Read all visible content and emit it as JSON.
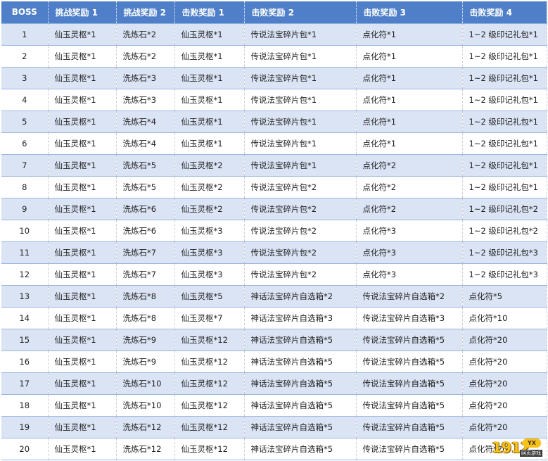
{
  "table": {
    "headers": [
      "BOSS",
      "挑战奖励 1",
      "挑战奖励 2",
      "击败奖励 1",
      "击败奖励 2",
      "击败奖励 3",
      "击败奖励 4"
    ],
    "rows": [
      [
        "1",
        "仙玉灵枢*1",
        "洗炼石*2",
        "仙玉灵枢*1",
        "传说法宝碎片包*1",
        "点化符*1",
        "1~2 级印记礼包*1"
      ],
      [
        "2",
        "仙玉灵枢*1",
        "洗炼石*2",
        "仙玉灵枢*1",
        "传说法宝碎片包*1",
        "点化符*1",
        "1~2 级印记礼包*1"
      ],
      [
        "3",
        "仙玉灵枢*1",
        "洗炼石*3",
        "仙玉灵枢*1",
        "传说法宝碎片包*1",
        "点化符*1",
        "1~2 级印记礼包*1"
      ],
      [
        "4",
        "仙玉灵枢*1",
        "洗炼石*3",
        "仙玉灵枢*1",
        "传说法宝碎片包*1",
        "点化符*1",
        "1~2 级印记礼包*1"
      ],
      [
        "5",
        "仙玉灵枢*1",
        "洗炼石*4",
        "仙玉灵枢*1",
        "传说法宝碎片包*1",
        "点化符*1",
        "1~2 级印记礼包*1"
      ],
      [
        "6",
        "仙玉灵枢*1",
        "洗炼石*4",
        "仙玉灵枢*1",
        "传说法宝碎片包*1",
        "点化符*1",
        "1~2 级印记礼包*1"
      ],
      [
        "7",
        "仙玉灵枢*1",
        "洗炼石*5",
        "仙玉灵枢*2",
        "传说法宝碎片包*1",
        "点化符*2",
        "1~2 级印记礼包*1"
      ],
      [
        "8",
        "仙玉灵枢*1",
        "洗炼石*5",
        "仙玉灵枢*2",
        "传说法宝碎片包*2",
        "点化符*2",
        "1~2 级印记礼包*1"
      ],
      [
        "9",
        "仙玉灵枢*1",
        "洗炼石*6",
        "仙玉灵枢*2",
        "传说法宝碎片包*2",
        "点化符*2",
        "1~2 级印记礼包*2"
      ],
      [
        "10",
        "仙玉灵枢*1",
        "洗炼石*6",
        "仙玉灵枢*3",
        "传说法宝碎片包*2",
        "点化符*3",
        "1~2 级印记礼包*2"
      ],
      [
        "11",
        "仙玉灵枢*1",
        "洗炼石*7",
        "仙玉灵枢*3",
        "传说法宝碎片包*2",
        "点化符*3",
        "1~2 级印记礼包*3"
      ],
      [
        "12",
        "仙玉灵枢*1",
        "洗炼石*7",
        "仙玉灵枢*3",
        "传说法宝碎片包*2",
        "点化符*3",
        "1~2 级印记礼包*3"
      ],
      [
        "13",
        "仙玉灵枢*1",
        "洗炼石*8",
        "仙玉灵枢*5",
        "神话法宝碎片自选箱*2",
        "传说法宝碎片自选箱*2",
        "点化符*5"
      ],
      [
        "14",
        "仙玉灵枢*1",
        "洗炼石*8",
        "仙玉灵枢*7",
        "神话法宝碎片自选箱*3",
        "传说法宝碎片自选箱*3",
        "点化符*10"
      ],
      [
        "15",
        "仙玉灵枢*1",
        "洗炼石*9",
        "仙玉灵枢*12",
        "神话法宝碎片自选箱*5",
        "传说法宝碎片自选箱*5",
        "点化符*20"
      ],
      [
        "16",
        "仙玉灵枢*1",
        "洗炼石*9",
        "仙玉灵枢*12",
        "神话法宝碎片自选箱*5",
        "传说法宝碎片自选箱*5",
        "点化符*20"
      ],
      [
        "17",
        "仙玉灵枢*1",
        "洗炼石*10",
        "仙玉灵枢*12",
        "神话法宝碎片自选箱*5",
        "传说法宝碎片自选箱*5",
        "点化符*20"
      ],
      [
        "18",
        "仙玉灵枢*1",
        "洗炼石*10",
        "仙玉灵枢*12",
        "神话法宝碎片自选箱*5",
        "传说法宝碎片自选箱*5",
        "点化符*20"
      ],
      [
        "19",
        "仙玉灵枢*1",
        "洗炼石*12",
        "仙玉灵枢*12",
        "神话法宝碎片自选箱*5",
        "传说法宝碎片自选箱*5",
        "点化符*20"
      ],
      [
        "20",
        "仙玉灵枢*1",
        "洗炼石*12",
        "仙玉灵枢*12",
        "神话法宝碎片自选箱*5",
        "传说法宝碎片自选箱*5",
        "点化符*20"
      ]
    ]
  },
  "watermark": {
    "number": "1912",
    "badge": "YX",
    "subtitle": "网页游戏"
  },
  "colors": {
    "header_bg": "#4f7fc8",
    "stripe_bg": "#dbe4f5",
    "watermark": "#f6c21a"
  }
}
